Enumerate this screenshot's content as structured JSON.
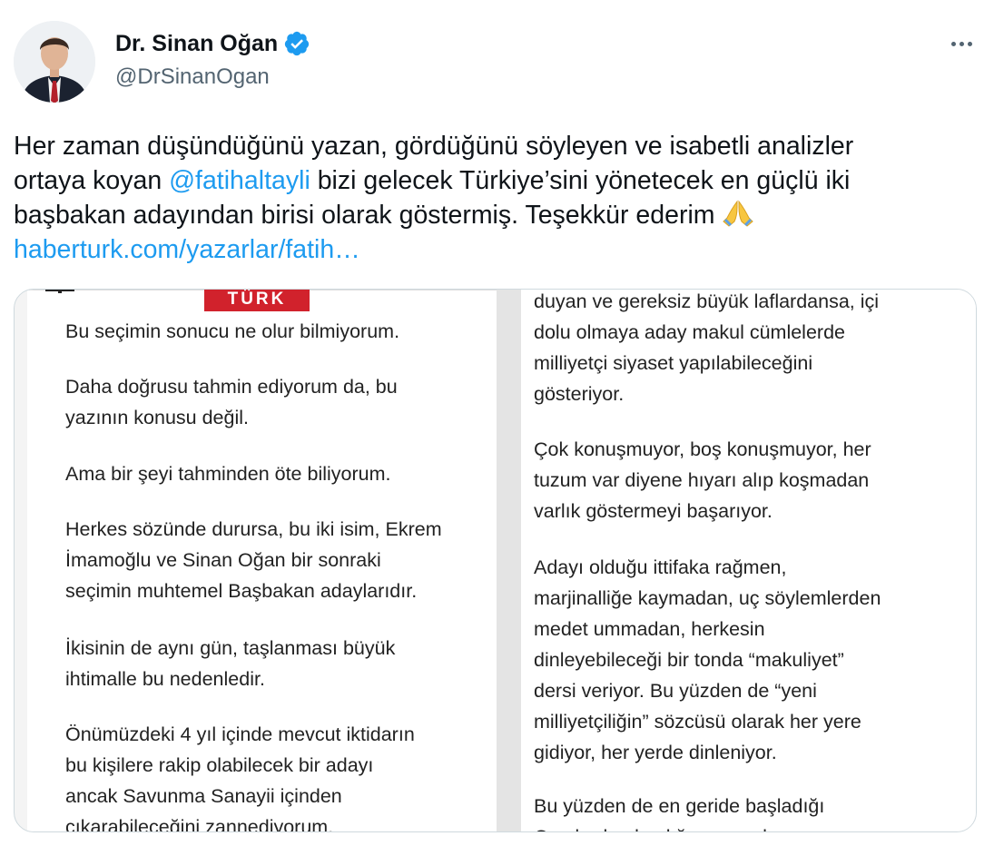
{
  "tweet": {
    "author": {
      "display_name": "Dr. Sinan Oğan",
      "handle": "@DrSinanOgan",
      "verified": true
    },
    "text_lines": [
      [
        "Her zaman düşündüğünü yazan, gördüğünü söyleyen ve isabetli analizler"
      ],
      [
        "ortaya koyan ",
        "@fatihaltayli",
        " bizi gelecek Türkiye’sini yönetecek en güçlü iki"
      ],
      [
        "başbakan adayından birisi olarak göstermiş. Teşekkür ederim "
      ],
      [
        "haberturk.com/yazarlar/fatih…"
      ]
    ],
    "mention": "@fatihaltayli",
    "link": "haberturk.com/yazarlar/fatih…",
    "emoji": "folded-hands"
  },
  "image_card": {
    "logo_text": "TÜRK",
    "left_column": [
      [
        "Bu seçimin sonucu ne olur bilmiyorum."
      ],
      [
        "Daha doğrusu tahmin ediyorum da, bu",
        "yazının konusu değil."
      ],
      [
        "Ama bir şeyi tahminden öte biliyorum."
      ],
      [
        "Herkes sözünde durursa, bu iki isim, Ekrem",
        "İmamoğlu ve Sinan Oğan bir sonraki",
        "seçimin muhtemel Başbakan adaylarıdır."
      ],
      [
        "İkisinin de aynı gün, taşlanması büyük",
        "ihtimalle bu nedenledir."
      ],
      [
        "Önümüzdeki 4 yıl içinde mevcut iktidarın",
        "bu kişilere rakip olabilecek bir adayı",
        "ancak Savunma Sanayii içinden",
        "çıkarabileceğini zannediyorum."
      ]
    ],
    "right_column": [
      [
        "duyan ve gereksiz büyük laflardansa, içi",
        "dolu olmaya aday makul cümlelerde",
        "milliyetçi siyaset yapılabileceğini",
        "gösteriyor."
      ],
      [
        "Çok konuşmuyor, boş konuşmuyor, her",
        "tuzum var diyene hıyarı alıp koşmadan",
        "varlık göstermeyi başarıyor."
      ],
      [
        "Adayı olduğu ittifaka rağmen,",
        "marjinalliğe kaymadan, uç söylemlerden",
        "medet ummadan, herkesin",
        "dinleyebileceği bir tonda “makuliyet”",
        "dersi veriyor. Bu yüzden de “yeni",
        "milliyetçiliğin” sözcüsü olarak her yere",
        "gidiyor, her yerde dinleniyor."
      ],
      [
        "Bu yüzden de en geride başladığı",
        "Cumhurbaşkanlığı yarışında oyunu"
      ]
    ]
  },
  "colors": {
    "link": "#1d9bf0",
    "verified_badge": "#1d9bf0",
    "secondary_text": "#536471",
    "logo_red": "#d1222c"
  }
}
